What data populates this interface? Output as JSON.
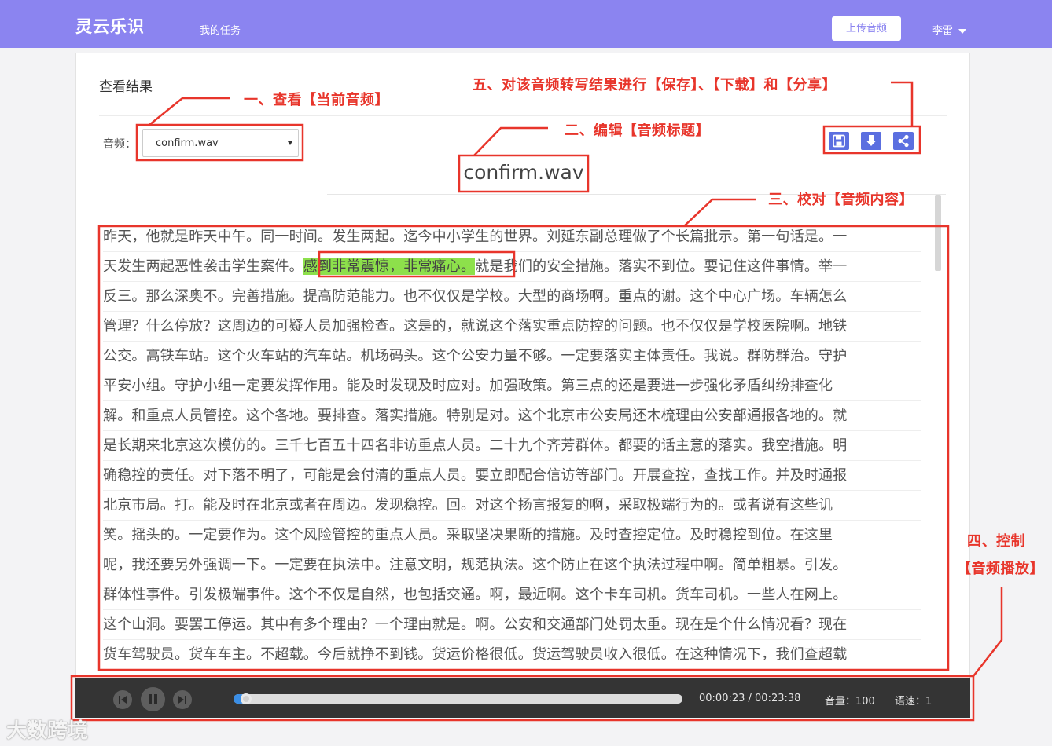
{
  "header": {
    "brand": "灵云乐识",
    "nav_tasks": "我的任务",
    "upload_label": "上传音频",
    "user_name": "李雷"
  },
  "page": {
    "title": "查看结果",
    "audio_label": "音频：",
    "audio_selected": "confirm.wav",
    "audio_title": "confirm.wav"
  },
  "toolbar": {
    "save_icon": "save-icon",
    "download_icon": "download-icon",
    "share_icon": "share-icon"
  },
  "transcript": {
    "highlight_color": "#8de04b",
    "lines": [
      [
        "昨天，他就是昨天中午。同一时间。发生两起。迄今中小学生的世界。刘延东副总理做了个长篇批示。第一句话是。一"
      ],
      [
        "天发生两起恶性袭击学生案件。",
        "感到非常震惊，非常痛心。",
        "就是我们的安全措施。落实不到位。要记住这件事情。举一"
      ],
      [
        "反三。那么深奥不。完善措施。提高防范能力。也不仅仅是学校。大型的商场啊。重点的谢。这个中心广场。车辆怎么"
      ],
      [
        "管理？什么停放？这周边的可疑人员加强检查。这是的，就说这个落实重点防控的问题。也不仅仅是学校医院啊。地铁"
      ],
      [
        "公交。高铁车站。这个火车站的汽车站。机场码头。这个公安力量不够。一定要落实主体责任。我说。群防群治。守护"
      ],
      [
        "平安小组。守护小组一定要发挥作用。能及时发现及时应对。加强政策。第三点的还是要进一步强化矛盾纠纷排查化"
      ],
      [
        "解。和重点人员管控。这个各地。要排查。落实措施。特别是对。这个北京市公安局还木梳理由公安部通报各地的。就"
      ],
      [
        "是长期来北京这次模仿的。三千七百五十四名非访重点人员。二十九个齐芳群体。都要的话主意的落实。我空措施。明"
      ],
      [
        "确稳控的责任。对下落不明了，可能是会付清的重点人员。要立即配合信访等部门。开展查控，查找工作。并及时通报"
      ],
      [
        "北京市局。打。能及时在北京或者在周边。发现稳控。回。对这个扬言报复的啊，采取极端行为的。或者说有这些讥"
      ],
      [
        "笑。摇头的。一定要作为。这个风险管控的重点人员。采取坚决果断的措施。及时查控定位。及时稳控到位。在这里"
      ],
      [
        "呢，我还要另外强调一下。一定要在执法中。注意文明，规范执法。这个防止在这个执法过程中啊。简单粗暴。引发。"
      ],
      [
        "群体性事件。引发极端事件。这个不仅是自然，也包括交通。啊，最近啊。这个卡车司机。货车司机。一些人在网上。"
      ],
      [
        "这个山洞。要罢工停运。其中有多个理由？一个理由就是。啊。公安和交通部门处罚太重。现在是个什么情况看？现在"
      ],
      [
        "货车驾驶员。货车车主。不超载。今后就挣不到钱。货运价格很低。货运驾驶员收入很低。在这种情况下，我们查超载"
      ]
    ]
  },
  "player": {
    "progress_fraction": 0.016,
    "time_display": "00:00:23 / 00:23:38",
    "volume_label": "音量：100",
    "speed_label": "语速：1",
    "progress_color": "#3a8ee6"
  },
  "annotations": {
    "a1": "一、查看【当前音频】",
    "a2": "二、编辑【音频标题】",
    "a3": "三、校对【音频内容】",
    "a4_line1": "四、控制",
    "a4_line2": "【音频播放】",
    "a5": "五、对该音频转写结果进行【保存】、【下载】和【分享】",
    "color": "#e8352b"
  },
  "watermark": "大数跨境"
}
